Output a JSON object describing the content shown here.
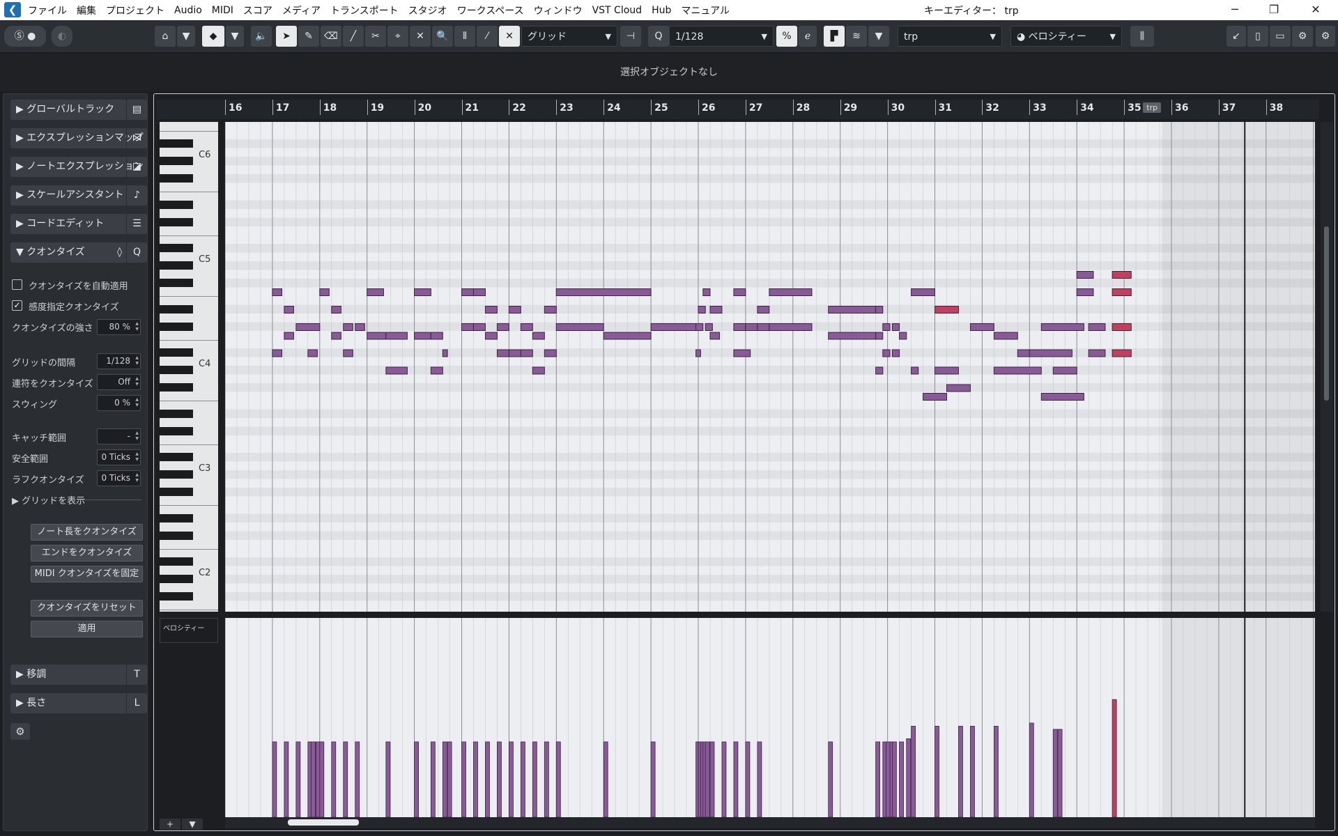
{
  "app": {
    "window_title": "キーエディター： trp",
    "menu": [
      "ファイル",
      "編集",
      "プロジェクト",
      "Audio",
      "MIDI",
      "スコア",
      "メディア",
      "トランスポート",
      "スタジオ",
      "ワークスペース",
      "ウィンドウ",
      "VST Cloud",
      "Hub",
      "マニュアル"
    ]
  },
  "toolbar": {
    "snap_type": "グリッド",
    "quantize_value": "1/128",
    "part_selector": "trp",
    "controller_selector": "ベロシティー"
  },
  "infoline": {
    "text": "選択オブジェクトなし"
  },
  "inspector": {
    "sections": [
      {
        "label": "グローバルトラック",
        "expanded": false
      },
      {
        "label": "エクスプレッションマップ",
        "expanded": false
      },
      {
        "label": "ノートエクスプレッション",
        "expanded": false
      },
      {
        "label": "スケールアシスタント",
        "expanded": false
      },
      {
        "label": "コードエディット",
        "expanded": false
      },
      {
        "label": "クオンタイズ",
        "expanded": true
      }
    ],
    "quantize": {
      "auto_apply_label": "クオンタイズを自動適用",
      "auto_apply": false,
      "iq_label": "感度指定クオンタイズ",
      "iq": true,
      "strength_label": "クオンタイズの強さ",
      "strength_value": "80 %",
      "grid_label": "グリッドの間隔",
      "grid_value": "1/128",
      "tuplet_label": "連符をクオンタイズ",
      "tuplet_value": "Off",
      "swing_label": "スウィング",
      "swing_value": "0 %",
      "catch_label": "キャッチ範囲",
      "catch_value": "-",
      "safe_label": "安全範囲",
      "safe_value": "0 Ticks",
      "rough_label": "ラフクオンタイズ",
      "rough_value": "0 Ticks",
      "show_grid_label": "グリッドを表示",
      "btn_length": "ノート長をクオンタイズ",
      "btn_ends": "エンドをクオンタイズ",
      "btn_freeze": "MIDI クオンタイズを固定",
      "btn_reset": "クオンタイズをリセット",
      "btn_apply": "適用"
    },
    "transpose_label": "移調",
    "length_label": "長さ"
  },
  "ruler": {
    "bars": [
      "16",
      "17",
      "18",
      "19",
      "20",
      "21",
      "22",
      "23",
      "24",
      "25",
      "26",
      "27",
      "28",
      "29",
      "30",
      "31",
      "32",
      "33",
      "34",
      "35",
      "36",
      "37",
      "38"
    ],
    "part_tag": "trp"
  },
  "keyboard": {
    "octave_labels": [
      "C6",
      "C5",
      "C4",
      "C3",
      "C2"
    ]
  },
  "controller_lane": {
    "label": "ベロシティー"
  },
  "colors": {
    "note": "#8a5a98",
    "note_selected": "#c2405e",
    "grid_bg": "#eceef1"
  },
  "notes_rows_hint": "note rows relative to C4",
  "notes": [
    {
      "bar": 17.0,
      "len": 0.2,
      "p": 9
    },
    {
      "bar": 17.25,
      "len": 0.2,
      "p": 7
    },
    {
      "bar": 17.25,
      "len": 0.2,
      "p": 4
    },
    {
      "bar": 17.0,
      "len": 0.2,
      "p": 2
    },
    {
      "bar": 17.5,
      "len": 0.5,
      "p": 5
    },
    {
      "bar": 18.0,
      "len": 0.2,
      "p": 9
    },
    {
      "bar": 17.75,
      "len": 0.2,
      "p": 2
    },
    {
      "bar": 18.25,
      "len": 0.2,
      "p": 7
    },
    {
      "bar": 18.25,
      "len": 0.2,
      "p": 4
    },
    {
      "bar": 18.5,
      "len": 0.2,
      "p": 5
    },
    {
      "bar": 18.5,
      "len": 0.2,
      "p": 2
    },
    {
      "bar": 18.75,
      "len": 0.2,
      "p": 5
    },
    {
      "bar": 19.0,
      "len": 0.35,
      "p": 9
    },
    {
      "bar": 19.0,
      "len": 0.4,
      "p": 4
    },
    {
      "bar": 19.4,
      "len": 0.45,
      "p": 4
    },
    {
      "bar": 19.4,
      "len": 0.45,
      "p": 0
    },
    {
      "bar": 20.0,
      "len": 0.35,
      "p": 9
    },
    {
      "bar": 20.0,
      "len": 0.35,
      "p": 4
    },
    {
      "bar": 20.35,
      "len": 0.25,
      "p": 4
    },
    {
      "bar": 20.35,
      "len": 0.25,
      "p": 0
    },
    {
      "bar": 20.6,
      "len": 0.1,
      "p": 2
    },
    {
      "bar": 21.0,
      "len": 0.25,
      "p": 9
    },
    {
      "bar": 21.0,
      "len": 0.25,
      "p": 5
    },
    {
      "bar": 21.25,
      "len": 0.25,
      "p": 9
    },
    {
      "bar": 21.25,
      "len": 0.25,
      "p": 5
    },
    {
      "bar": 21.5,
      "len": 0.25,
      "p": 7
    },
    {
      "bar": 21.5,
      "len": 0.25,
      "p": 4
    },
    {
      "bar": 21.75,
      "len": 0.25,
      "p": 5
    },
    {
      "bar": 21.75,
      "len": 0.25,
      "p": 2
    },
    {
      "bar": 22.0,
      "len": 0.25,
      "p": 7
    },
    {
      "bar": 22.0,
      "len": 0.25,
      "p": 2
    },
    {
      "bar": 22.25,
      "len": 0.25,
      "p": 5
    },
    {
      "bar": 22.25,
      "len": 0.25,
      "p": 2
    },
    {
      "bar": 22.5,
      "len": 0.25,
      "p": 4
    },
    {
      "bar": 22.5,
      "len": 0.25,
      "p": 0
    },
    {
      "bar": 22.75,
      "len": 0.25,
      "p": 7
    },
    {
      "bar": 22.75,
      "len": 0.25,
      "p": 2
    },
    {
      "bar": 23.0,
      "len": 2.0,
      "p": 9
    },
    {
      "bar": 23.0,
      "len": 1.0,
      "p": 5
    },
    {
      "bar": 24.0,
      "len": 1.0,
      "p": 4
    },
    {
      "bar": 25.0,
      "len": 1.0,
      "p": 5
    },
    {
      "bar": 26.1,
      "len": 0.15,
      "p": 9
    },
    {
      "bar": 26.0,
      "len": 0.15,
      "p": 7
    },
    {
      "bar": 25.95,
      "len": 0.15,
      "p": 5
    },
    {
      "bar": 26.15,
      "len": 0.15,
      "p": 5
    },
    {
      "bar": 26.25,
      "len": 0.25,
      "p": 7
    },
    {
      "bar": 26.25,
      "len": 0.2,
      "p": 4
    },
    {
      "bar": 25.95,
      "len": 0.1,
      "p": 2
    },
    {
      "bar": 26.75,
      "len": 0.25,
      "p": 9
    },
    {
      "bar": 26.75,
      "len": 0.25,
      "p": 5
    },
    {
      "bar": 26.75,
      "len": 0.35,
      "p": 2
    },
    {
      "bar": 27.0,
      "len": 0.25,
      "p": 5
    },
    {
      "bar": 27.25,
      "len": 0.25,
      "p": 7
    },
    {
      "bar": 27.25,
      "len": 0.25,
      "p": 5
    },
    {
      "bar": 27.5,
      "len": 0.9,
      "p": 9
    },
    {
      "bar": 27.5,
      "len": 0.9,
      "p": 5
    },
    {
      "bar": 28.75,
      "len": 1.0,
      "p": 7
    },
    {
      "bar": 28.75,
      "len": 1.0,
      "p": 4
    },
    {
      "bar": 29.75,
      "len": 0.15,
      "p": 7
    },
    {
      "bar": 29.9,
      "len": 0.15,
      "p": 5
    },
    {
      "bar": 29.75,
      "len": 0.15,
      "p": 4
    },
    {
      "bar": 29.9,
      "len": 0.15,
      "p": 2
    },
    {
      "bar": 30.1,
      "len": 0.15,
      "p": 5
    },
    {
      "bar": 30.1,
      "len": 0.15,
      "p": 2
    },
    {
      "bar": 30.25,
      "len": 0.15,
      "p": 4
    },
    {
      "bar": 29.75,
      "len": 0.15,
      "p": 0
    },
    {
      "bar": 30.5,
      "len": 0.5,
      "p": 9
    },
    {
      "bar": 30.5,
      "len": 0.15,
      "p": 0
    },
    {
      "bar": 30.75,
      "len": 0.5,
      "p": -3
    },
    {
      "bar": 31.0,
      "len": 0.5,
      "p": 7,
      "sel": true
    },
    {
      "bar": 31.25,
      "len": 0.5,
      "p": -2
    },
    {
      "bar": 31.0,
      "len": 0.5,
      "p": 0
    },
    {
      "bar": 31.75,
      "len": 0.5,
      "p": 5
    },
    {
      "bar": 32.25,
      "len": 0.5,
      "p": 4
    },
    {
      "bar": 32.25,
      "len": 1.0,
      "p": 0
    },
    {
      "bar": 32.75,
      "len": 0.5,
      "p": 2
    },
    {
      "bar": 33.0,
      "len": 0.9,
      "p": 2
    },
    {
      "bar": 33.25,
      "len": 0.9,
      "p": 5
    },
    {
      "bar": 33.5,
      "len": 0.5,
      "p": 0
    },
    {
      "bar": 33.25,
      "len": 0.9,
      "p": -3
    },
    {
      "bar": 34.0,
      "len": 0.35,
      "p": 9
    },
    {
      "bar": 34.25,
      "len": 0.35,
      "p": 5
    },
    {
      "bar": 34.25,
      "len": 0.35,
      "p": 2
    },
    {
      "bar": 34.0,
      "len": 0.35,
      "p": 11
    },
    {
      "bar": 34.75,
      "len": 0.4,
      "p": 11,
      "sel": true
    },
    {
      "bar": 34.75,
      "len": 0.4,
      "p": 9,
      "sel": true
    },
    {
      "bar": 34.75,
      "len": 0.4,
      "p": 5,
      "sel": true
    },
    {
      "bar": 34.75,
      "len": 0.4,
      "p": 2,
      "sel": true
    }
  ],
  "velocities": [
    {
      "bar": 17.0,
      "v": 48
    },
    {
      "bar": 17.25,
      "v": 48
    },
    {
      "bar": 17.5,
      "v": 48
    },
    {
      "bar": 17.75,
      "v": 48
    },
    {
      "bar": 17.82,
      "v": 48
    },
    {
      "bar": 17.92,
      "v": 48
    },
    {
      "bar": 18.0,
      "v": 48
    },
    {
      "bar": 18.25,
      "v": 48
    },
    {
      "bar": 18.5,
      "v": 48
    },
    {
      "bar": 18.75,
      "v": 48
    },
    {
      "bar": 19.4,
      "v": 48
    },
    {
      "bar": 20.0,
      "v": 48
    },
    {
      "bar": 20.35,
      "v": 48
    },
    {
      "bar": 20.6,
      "v": 48
    },
    {
      "bar": 20.7,
      "v": 48
    },
    {
      "bar": 21.0,
      "v": 48
    },
    {
      "bar": 21.25,
      "v": 48
    },
    {
      "bar": 21.5,
      "v": 48
    },
    {
      "bar": 21.75,
      "v": 48
    },
    {
      "bar": 22.0,
      "v": 48
    },
    {
      "bar": 22.25,
      "v": 48
    },
    {
      "bar": 22.5,
      "v": 48
    },
    {
      "bar": 22.75,
      "v": 48
    },
    {
      "bar": 23.0,
      "v": 48
    },
    {
      "bar": 24.0,
      "v": 48
    },
    {
      "bar": 25.0,
      "v": 48
    },
    {
      "bar": 25.95,
      "v": 48
    },
    {
      "bar": 26.0,
      "v": 48
    },
    {
      "bar": 26.05,
      "v": 48
    },
    {
      "bar": 26.1,
      "v": 48
    },
    {
      "bar": 26.15,
      "v": 48
    },
    {
      "bar": 26.25,
      "v": 48
    },
    {
      "bar": 26.5,
      "v": 48
    },
    {
      "bar": 26.75,
      "v": 48
    },
    {
      "bar": 27.0,
      "v": 48
    },
    {
      "bar": 27.25,
      "v": 48
    },
    {
      "bar": 28.75,
      "v": 48
    },
    {
      "bar": 29.75,
      "v": 48
    },
    {
      "bar": 29.9,
      "v": 48
    },
    {
      "bar": 29.97,
      "v": 48
    },
    {
      "bar": 30.05,
      "v": 48
    },
    {
      "bar": 30.1,
      "v": 48
    },
    {
      "bar": 30.25,
      "v": 48
    },
    {
      "bar": 30.4,
      "v": 50
    },
    {
      "bar": 30.5,
      "v": 58
    },
    {
      "bar": 31.0,
      "v": 58
    },
    {
      "bar": 31.5,
      "v": 58
    },
    {
      "bar": 31.75,
      "v": 58
    },
    {
      "bar": 32.25,
      "v": 58
    },
    {
      "bar": 33.0,
      "v": 60
    },
    {
      "bar": 33.5,
      "v": 56
    },
    {
      "bar": 33.6,
      "v": 56
    },
    {
      "bar": 34.75,
      "v": 75,
      "sel": true
    }
  ]
}
